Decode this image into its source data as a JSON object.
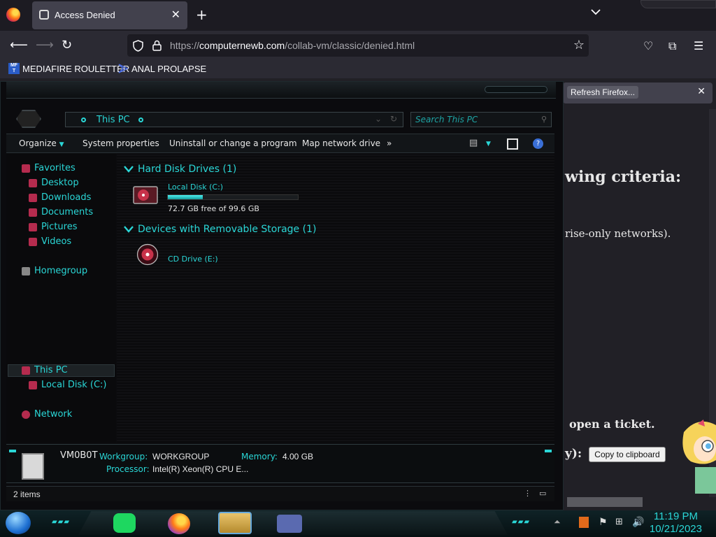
{
  "browser": {
    "tab_title": "Access Denied",
    "url_prefix": "https://",
    "url_host": "computernewb.com",
    "url_path": "/collab-vm/classic/denied.html",
    "bookmarks": [
      {
        "label": "MEDIAFIRE ROULETTER",
        "icon": "mediafire-icon",
        "icon_text": "MF T"
      },
      {
        "label": "ANAL PROLAPSE",
        "icon": "triangle-icon"
      }
    ],
    "notification": {
      "button": "Refresh Firefox..."
    }
  },
  "page": {
    "heading_fragment": "wing criteria:",
    "line_fragment": "rise-only networks).",
    "ticket_fragment": "open a ticket.",
    "copy_prefix": "y):",
    "copy_button": "Copy to clipboard"
  },
  "explorer": {
    "address": "This PC",
    "search_placeholder": "Search This PC",
    "commands": [
      "Organize",
      "System properties",
      "Uninstall or change a program",
      "Map network drive",
      "»"
    ],
    "sidebar": {
      "favorites": "Favorites",
      "favorites_items": [
        "Desktop",
        "Downloads",
        "Documents",
        "Pictures",
        "Videos"
      ],
      "homegroup": "Homegroup",
      "this_pc": "This PC",
      "this_pc_items": [
        "Local Disk (C:)"
      ],
      "network": "Network"
    },
    "groups": [
      {
        "title": "Hard Disk Drives (1)"
      },
      {
        "title": "Devices with Removable Storage (1)"
      }
    ],
    "drives": {
      "local": {
        "name": "Local Disk (C:)",
        "free": "72.7 GB free of 99.6 GB",
        "used_fraction": 0.27
      },
      "cd": {
        "name": "CD Drive (E:)"
      }
    },
    "details": {
      "name": "VM0B0T",
      "workgroup_label": "Workgroup:",
      "workgroup": "WORKGROUP",
      "memory_label": "Memory:",
      "memory": "4.00 GB",
      "processor_label": "Processor:",
      "processor": "Intel(R) Xeon(R) CPU E..."
    },
    "status": "2 items"
  },
  "taskbar": {
    "time": "11:19 PM",
    "date": "10/21/2023"
  },
  "colors": {
    "accent": "#2ad6d6",
    "drive_fill": "#1fb8b8",
    "browser_bg": "#2b2a33"
  }
}
